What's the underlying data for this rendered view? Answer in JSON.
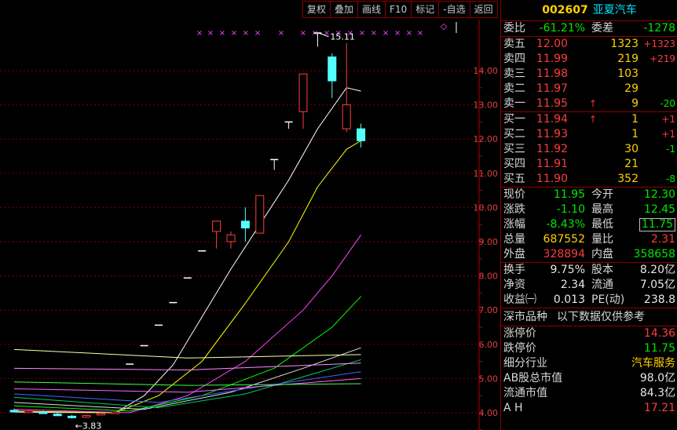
{
  "toolbar": {
    "buttons": [
      "复权",
      "叠加",
      "画线",
      "F10",
      "标记",
      "-自选",
      "返回"
    ]
  },
  "chart_data": {
    "type": "candlestick",
    "y_ticks": [
      "14.00",
      "13.00",
      "12.00",
      "11.00",
      "10.00",
      "9.00",
      "8.00",
      "7.00",
      "6.00",
      "5.00",
      "4.00"
    ],
    "ylim": [
      3.75,
      15.5
    ],
    "high_label": "15.11",
    "low_label": "3.83",
    "high_label_prefix": "",
    "low_label_prefix": "←",
    "candles": [
      {
        "o": 4.07,
        "c": 4.04,
        "h": 4.12,
        "l": 4.01
      },
      {
        "o": 4.03,
        "c": 4.05,
        "h": 4.09,
        "l": 4.01
      },
      {
        "o": 4.02,
        "c": 4.0,
        "h": 4.06,
        "l": 3.97
      },
      {
        "o": 3.96,
        "c": 3.93,
        "h": 4.0,
        "l": 3.9
      },
      {
        "o": 3.9,
        "c": 3.88,
        "h": 3.94,
        "l": 3.83
      },
      {
        "o": 3.88,
        "c": 3.92,
        "h": 3.95,
        "l": 3.85
      },
      {
        "o": 3.95,
        "c": 3.98,
        "h": 4.02,
        "l": 3.93
      },
      {
        "o": 4.0,
        "c": 4.02,
        "h": 4.05,
        "l": 3.97
      },
      {
        "o": 5.42,
        "c": 5.42,
        "h": 5.42,
        "l": 5.42
      },
      {
        "o": 5.96,
        "c": 5.96,
        "h": 5.96,
        "l": 5.96
      },
      {
        "o": 6.56,
        "c": 6.56,
        "h": 6.56,
        "l": 6.56
      },
      {
        "o": 7.22,
        "c": 7.22,
        "h": 7.22,
        "l": 7.22
      },
      {
        "o": 7.94,
        "c": 7.94,
        "h": 7.94,
        "l": 7.94
      },
      {
        "o": 8.73,
        "c": 8.73,
        "h": 8.73,
        "l": 8.73
      },
      {
        "o": 9.3,
        "c": 9.6,
        "h": 9.6,
        "l": 8.8
      },
      {
        "o": 9.0,
        "c": 9.2,
        "h": 9.3,
        "l": 8.8
      },
      {
        "o": 9.6,
        "c": 9.4,
        "h": 10.0,
        "l": 9.0
      },
      {
        "o": 9.25,
        "c": 10.35,
        "h": 10.35,
        "l": 9.25
      },
      {
        "o": 11.4,
        "c": 11.4,
        "h": 11.4,
        "l": 11.1
      },
      {
        "o": 12.5,
        "c": 12.5,
        "h": 12.5,
        "l": 12.3
      },
      {
        "o": 12.8,
        "c": 13.9,
        "h": 13.9,
        "l": 12.3
      },
      {
        "o": 15.1,
        "c": 15.1,
        "h": 15.11,
        "l": 14.7
      },
      {
        "o": 14.4,
        "c": 13.7,
        "h": 14.5,
        "l": 13.2
      },
      {
        "o": 12.3,
        "c": 13.0,
        "h": 14.8,
        "l": 12.2
      },
      {
        "o": 12.3,
        "c": 11.95,
        "h": 12.45,
        "l": 11.75
      }
    ],
    "ma_lines": [
      {
        "color": "#ffffff",
        "points": [
          [
            0,
            4.02
          ],
          [
            3,
            4.01
          ],
          [
            7,
            4.0
          ],
          [
            9,
            4.5
          ],
          [
            11,
            5.4
          ],
          [
            13,
            6.8
          ],
          [
            15,
            8.2
          ],
          [
            17,
            9.5
          ],
          [
            19,
            10.8
          ],
          [
            21,
            12.3
          ],
          [
            23,
            13.5
          ],
          [
            24,
            13.4
          ]
        ]
      },
      {
        "color": "#ffff00",
        "points": [
          [
            0,
            4.05
          ],
          [
            7,
            4.0
          ],
          [
            10,
            4.5
          ],
          [
            13,
            5.5
          ],
          [
            16,
            7.2
          ],
          [
            19,
            9.0
          ],
          [
            21,
            10.6
          ],
          [
            23,
            11.7
          ],
          [
            24,
            11.95
          ]
        ]
      },
      {
        "color": "#ff44ff",
        "points": [
          [
            0,
            4.1
          ],
          [
            8,
            4.0
          ],
          [
            12,
            4.5
          ],
          [
            16,
            5.5
          ],
          [
            20,
            7.0
          ],
          [
            22,
            8.0
          ],
          [
            24,
            9.2
          ]
        ]
      },
      {
        "color": "#00ff00",
        "points": [
          [
            0,
            4.2
          ],
          [
            8,
            4.05
          ],
          [
            13,
            4.5
          ],
          [
            18,
            5.3
          ],
          [
            22,
            6.5
          ],
          [
            24,
            7.4
          ]
        ]
      },
      {
        "color": "#e0e0e0",
        "points": [
          [
            0,
            4.3
          ],
          [
            9,
            4.1
          ],
          [
            15,
            4.6
          ],
          [
            20,
            5.3
          ],
          [
            24,
            5.9
          ]
        ]
      },
      {
        "color": "#00cc66",
        "points": [
          [
            0,
            4.45
          ],
          [
            10,
            4.15
          ],
          [
            16,
            4.55
          ],
          [
            24,
            5.55
          ]
        ]
      },
      {
        "color": "#4466ff",
        "points": [
          [
            0,
            4.55
          ],
          [
            10,
            4.3
          ],
          [
            16,
            4.7
          ],
          [
            24,
            5.2
          ]
        ]
      },
      {
        "color": "#ff66ff",
        "points": [
          [
            0,
            4.7
          ],
          [
            12,
            4.6
          ],
          [
            24,
            5.0
          ]
        ]
      },
      {
        "color": "#ffffaa",
        "points": [
          [
            0,
            5.85
          ],
          [
            12,
            5.6
          ],
          [
            24,
            5.7
          ]
        ]
      },
      {
        "color": "#ff88ff",
        "points": [
          [
            0,
            5.3
          ],
          [
            12,
            5.25
          ],
          [
            24,
            5.45
          ]
        ]
      },
      {
        "color": "#44ff44",
        "points": [
          [
            0,
            4.9
          ],
          [
            12,
            4.8
          ],
          [
            24,
            4.85
          ]
        ]
      }
    ]
  },
  "quote": {
    "code": "002607",
    "name": "亚夏汽车",
    "weibi_label": "委比",
    "weibi_value": "-61.21%",
    "weicha_label": "委差",
    "weicha_value": "-1278",
    "asks": [
      {
        "label": "卖五",
        "price": "12.00",
        "vol": "1323",
        "chg": "+1323",
        "arrow": ""
      },
      {
        "label": "卖四",
        "price": "11.99",
        "vol": "219",
        "chg": "+219",
        "arrow": ""
      },
      {
        "label": "卖三",
        "price": "11.98",
        "vol": "103",
        "chg": "",
        "arrow": ""
      },
      {
        "label": "卖二",
        "price": "11.97",
        "vol": "29",
        "chg": "",
        "arrow": ""
      },
      {
        "label": "卖一",
        "price": "11.95",
        "vol": "9",
        "chg": "-20",
        "arrow": "↑"
      }
    ],
    "bids": [
      {
        "label": "买一",
        "price": "11.94",
        "vol": "1",
        "chg": "+1",
        "arrow": "↑"
      },
      {
        "label": "买二",
        "price": "11.93",
        "vol": "1",
        "chg": "+1",
        "arrow": ""
      },
      {
        "label": "买三",
        "price": "11.92",
        "vol": "30",
        "chg": "-1",
        "arrow": ""
      },
      {
        "label": "买四",
        "price": "11.91",
        "vol": "21",
        "chg": "",
        "arrow": ""
      },
      {
        "label": "买五",
        "price": "11.90",
        "vol": "352",
        "chg": "-8",
        "arrow": ""
      }
    ],
    "stats": [
      {
        "l1": "现价",
        "v1": "11.95",
        "c1": "green",
        "l2": "今开",
        "v2": "12.30",
        "c2": "green"
      },
      {
        "l1": "涨跌",
        "v1": "-1.10",
        "c1": "green",
        "l2": "最高",
        "v2": "12.45",
        "c2": "green"
      },
      {
        "l1": "涨幅",
        "v1": "-8.43%",
        "c1": "green",
        "l2": "最低",
        "v2": "11.75",
        "c2": "green"
      },
      {
        "l1": "总量",
        "v1": "687552",
        "c1": "yellow",
        "l2": "量比",
        "v2": "2.31",
        "c2": "red"
      },
      {
        "l1": "外盘",
        "v1": "328894",
        "c1": "red",
        "l2": "内盘",
        "v2": "358658",
        "c2": "green"
      }
    ],
    "fin": [
      {
        "l1": "换手",
        "v1": "9.75%",
        "l2": "股本",
        "v2": "8.20亿"
      },
      {
        "l1": "净资",
        "v1": "2.34",
        "l2": "流通",
        "v2": "7.05亿"
      },
      {
        "l1": "收益㈠",
        "v1": "0.013",
        "l2": "PE(动)",
        "v2": "238.8"
      }
    ],
    "market_label": "深市品种",
    "market_note": "以下数据仅供参考",
    "extra": [
      {
        "label": "涨停价",
        "value": "14.36",
        "color": "red"
      },
      {
        "label": "跌停价",
        "value": "11.75",
        "color": "green"
      },
      {
        "label": "细分行业",
        "value": "汽车服务",
        "color": "yellow"
      },
      {
        "label": "AB股总市值",
        "value": "98.0亿",
        "color": "white"
      },
      {
        "label": "流通市值",
        "value": "84.3亿",
        "color": "white"
      },
      {
        "label": "A H",
        "value": "17.21",
        "color": "red"
      }
    ]
  }
}
